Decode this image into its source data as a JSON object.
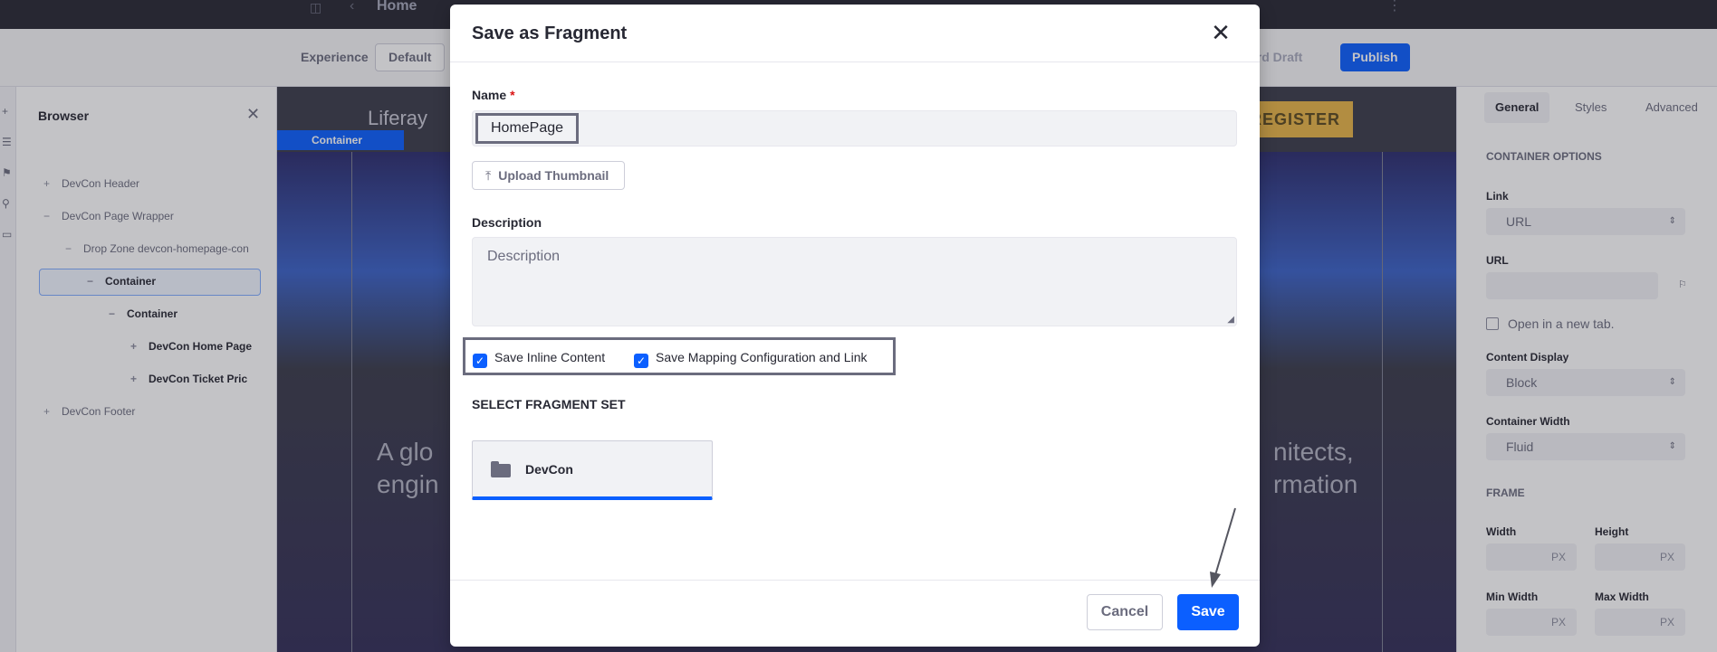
{
  "topbar": {
    "page_title": "Home"
  },
  "subbar": {
    "experience_label": "Experience",
    "experience_value": "Default",
    "discard_draft": "ard Draft",
    "publish": "Publish"
  },
  "browser": {
    "title": "Browser",
    "items": [
      {
        "sign": "+",
        "label": "DevCon Header"
      },
      {
        "sign": "−",
        "label": "DevCon Page Wrapper"
      },
      {
        "sign": "−",
        "label": "Drop Zone devcon-homepage-con"
      },
      {
        "sign": "−",
        "label": "Container"
      },
      {
        "sign": "−",
        "label": "Container"
      },
      {
        "sign": "+",
        "label": "DevCon Home Page"
      },
      {
        "sign": "+",
        "label": "DevCon Ticket Pric"
      },
      {
        "sign": "+",
        "label": "DevCon Footer"
      }
    ]
  },
  "canvas": {
    "logo": "Liferay",
    "container_tag": "Container",
    "register": "REGISTER",
    "hero_left_1": "A glo",
    "hero_left_2": "engin",
    "hero_right_1": "nitects,",
    "hero_right_2": "rmation"
  },
  "rightpanel": {
    "tabs": [
      "General",
      "Styles",
      "Advanced"
    ],
    "container_options": "CONTAINER OPTIONS",
    "link_label": "Link",
    "link_value": "URL",
    "url_label": "URL",
    "open_new_tab": "Open in a new tab.",
    "content_display_label": "Content Display",
    "content_display_value": "Block",
    "container_width_label": "Container Width",
    "container_width_value": "Fluid",
    "frame": "FRAME",
    "width_label": "Width",
    "height_label": "Height",
    "min_width_label": "Min Width",
    "max_width_label": "Max Width",
    "unit": "PX"
  },
  "modal": {
    "title": "Save as Fragment",
    "name_label": "Name",
    "required_mark": "*",
    "name_value": "HomePage",
    "upload_thumbnail": "Upload Thumbnail",
    "description_label": "Description",
    "description_placeholder": "Description",
    "save_inline_content": "Save Inline Content",
    "save_mapping": "Save Mapping Configuration and Link",
    "select_fragment_set": "SELECT FRAGMENT SET",
    "fragment_set": "DevCon",
    "cancel": "Cancel",
    "save": "Save"
  },
  "colors": {
    "primary": "#0b5fff",
    "text_dark": "#272833",
    "text_secondary": "#6b6c7e",
    "register_gold": "#e8b447"
  }
}
